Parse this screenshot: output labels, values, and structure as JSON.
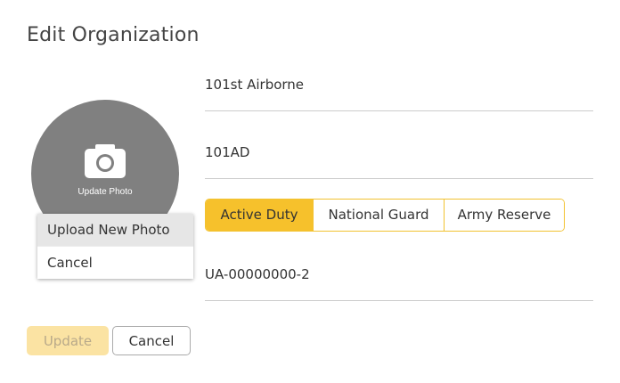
{
  "header": {
    "title": "Edit Organization"
  },
  "avatar": {
    "label": "Update Photo",
    "icon": "camera-icon"
  },
  "photo_menu": {
    "upload_label": "Upload New Photo",
    "cancel_label": "Cancel"
  },
  "form": {
    "name_value": "101st Airborne",
    "abbreviation_value": "101AD",
    "component_options": [
      "Active Duty",
      "National Guard",
      "Army Reserve"
    ],
    "component_selected": "Active Duty",
    "uic_value": "UA-00000000-2"
  },
  "actions": {
    "update_label": "Update",
    "cancel_label": "Cancel"
  },
  "colors": {
    "accent": "#f6c12c",
    "accent_border": "#f2c230",
    "disabled_accent": "#fbe3a3",
    "avatar_bg": "#808080"
  }
}
